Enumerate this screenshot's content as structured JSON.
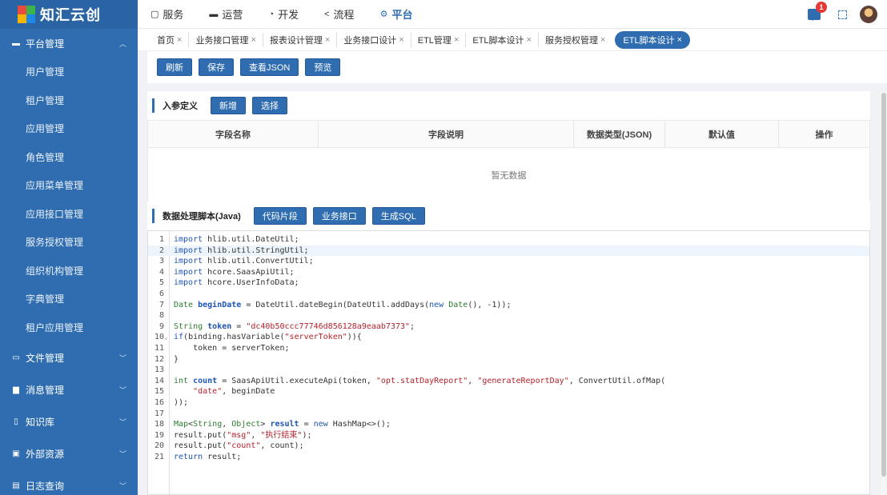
{
  "brand": {
    "name": "知汇云创"
  },
  "sidebar": {
    "group_main": {
      "label": "平台管理",
      "icon": "monitor-icon"
    },
    "items": [
      {
        "label": "用户管理"
      },
      {
        "label": "租户管理"
      },
      {
        "label": "应用管理"
      },
      {
        "label": "角色管理"
      },
      {
        "label": "应用菜单管理"
      },
      {
        "label": "应用接口管理"
      },
      {
        "label": "服务授权管理"
      },
      {
        "label": "组织机构管理"
      },
      {
        "label": "字典管理"
      },
      {
        "label": "租户应用管理"
      }
    ],
    "groups": [
      {
        "label": "文件管理",
        "icon": "folder-icon"
      },
      {
        "label": "消息管理",
        "icon": "message-icon"
      },
      {
        "label": "知识库",
        "icon": "book-icon"
      },
      {
        "label": "外部资源",
        "icon": "image-icon"
      },
      {
        "label": "日志查询",
        "icon": "document-icon"
      }
    ]
  },
  "topnav": [
    {
      "label": "服务",
      "icon": "chat-icon",
      "active": false
    },
    {
      "label": "运营",
      "icon": "monitor-icon",
      "active": false
    },
    {
      "label": "开发",
      "icon": "clock-icon",
      "active": false
    },
    {
      "label": "流程",
      "icon": "share-icon",
      "active": false
    },
    {
      "label": "平台",
      "icon": "settings-icon",
      "active": true
    }
  ],
  "notifications": {
    "count": "1"
  },
  "tabs": [
    {
      "label": "首页"
    },
    {
      "label": "业务接口管理"
    },
    {
      "label": "报表设计管理"
    },
    {
      "label": "业务接口设计"
    },
    {
      "label": "ETL管理"
    },
    {
      "label": "ETL脚本设计"
    },
    {
      "label": "服务授权管理"
    },
    {
      "label": "ETL脚本设计",
      "active": true
    }
  ],
  "toolbar": {
    "refresh": "刷新",
    "save": "保存",
    "view_json": "查看JSON",
    "preview": "预览"
  },
  "params": {
    "title": "入参定义",
    "add": "新增",
    "select": "选择",
    "columns": [
      "字段名称",
      "字段说明",
      "数据类型(JSON)",
      "默认值",
      "操作"
    ],
    "empty": "暂无数据"
  },
  "script": {
    "title": "数据处理脚本(Java)",
    "snippet": "代码片段",
    "biz_api": "业务接口",
    "gen_sql": "生成SQL",
    "highlighted_line": 2,
    "folded_line": 10,
    "lines": [
      "import hlib.util.DateUtil;",
      "import hlib.util.StringUtil;",
      "import hlib.util.ConvertUtil;",
      "import hcore.SaasApiUtil;",
      "import hcore.UserInfoData;",
      "",
      "Date beginDate = DateUtil.dateBegin(DateUtil.addDays(new Date(), -1));",
      "",
      "String token = \"dc40b50ccc77746d856128a9eaab7373\";",
      "if(binding.hasVariable(\"serverToken\")){",
      "    token = serverToken;",
      "}",
      "",
      "int count = SaasApiUtil.executeApi(token, \"opt.statDayReport\", \"generateReportDay\", ConvertUtil.ofMap(",
      "    \"date\", beginDate",
      "));",
      "",
      "Map<String, Object> result = new HashMap<>();",
      "result.put(\"msg\", \"执行结束\");",
      "result.put(\"count\", count);",
      "return result;"
    ]
  }
}
